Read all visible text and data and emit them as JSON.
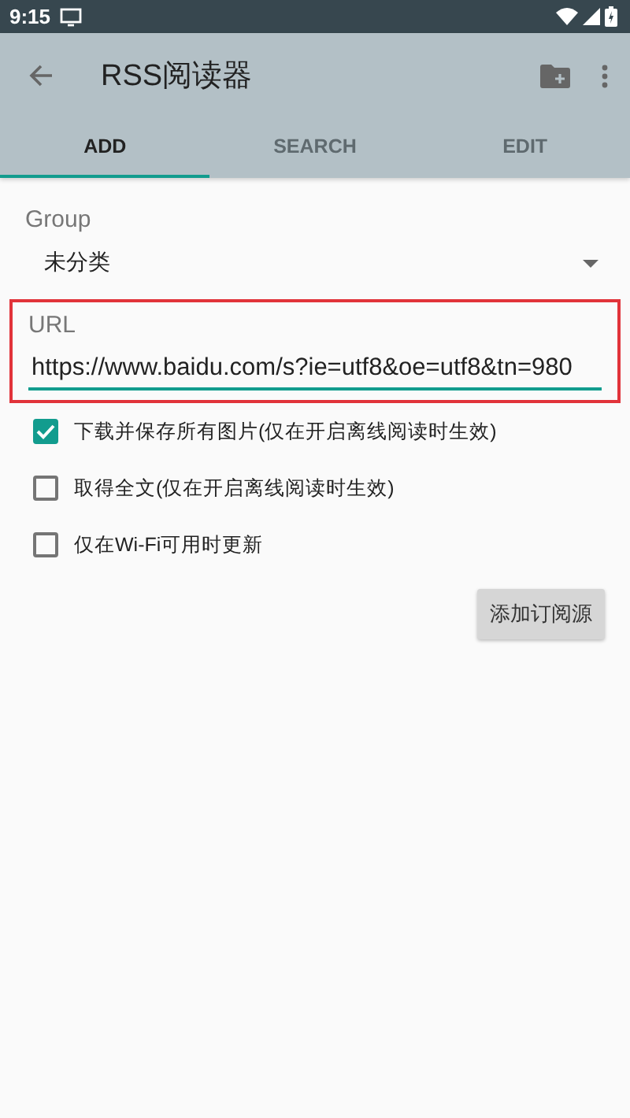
{
  "status_bar": {
    "time": "9:15"
  },
  "toolbar": {
    "title": "RSS阅读器"
  },
  "tabs": [
    {
      "label": "ADD",
      "selected": true
    },
    {
      "label": "SEARCH",
      "selected": false
    },
    {
      "label": "EDIT",
      "selected": false
    }
  ],
  "group": {
    "label": "Group",
    "value": "未分类"
  },
  "url": {
    "label": "URL",
    "value": "https://www.baidu.com/s?ie=utf8&oe=utf8&tn=980",
    "highlighted": true
  },
  "options": [
    {
      "label": "下载并保存所有图片(仅在开启离线阅读时生效)",
      "checked": true
    },
    {
      "label": "取得全文(仅在开启离线阅读时生效)",
      "checked": false
    },
    {
      "label": "仅在Wi-Fi可用时更新",
      "checked": false
    }
  ],
  "add_button": "添加订阅源"
}
